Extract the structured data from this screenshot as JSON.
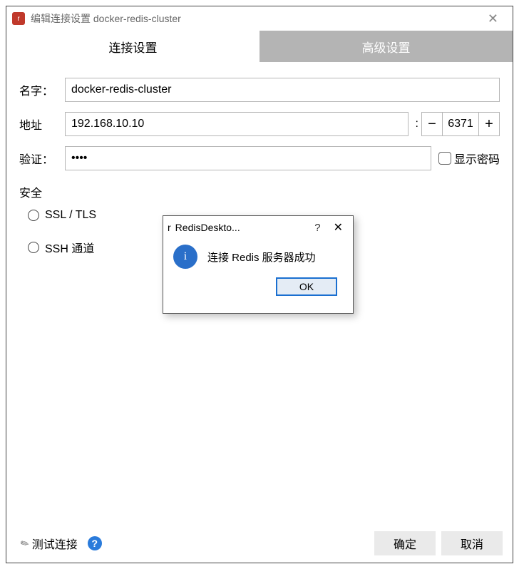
{
  "window": {
    "title": "编辑连接设置 docker-redis-cluster"
  },
  "tabs": {
    "connection": "连接设置",
    "advanced": "高级设置"
  },
  "labels": {
    "name": "名字：",
    "address": "地址",
    "auth": "验证：",
    "security": "安全",
    "ssl": "SSL / TLS",
    "ssh": "SSH 通道",
    "show_password": "显示密码"
  },
  "fields": {
    "name": "docker-redis-cluster",
    "address": "192.168.10.10",
    "port": "6371",
    "auth": "••••"
  },
  "buttons": {
    "minus": "−",
    "plus": "+",
    "test": "测试连接",
    "help": "?",
    "ok": "确定",
    "cancel": "取消"
  },
  "dialog": {
    "title": "RedisDeskto...",
    "help": "?",
    "message": "连接 Redis 服务器成功",
    "ok": "OK",
    "info": "i"
  }
}
